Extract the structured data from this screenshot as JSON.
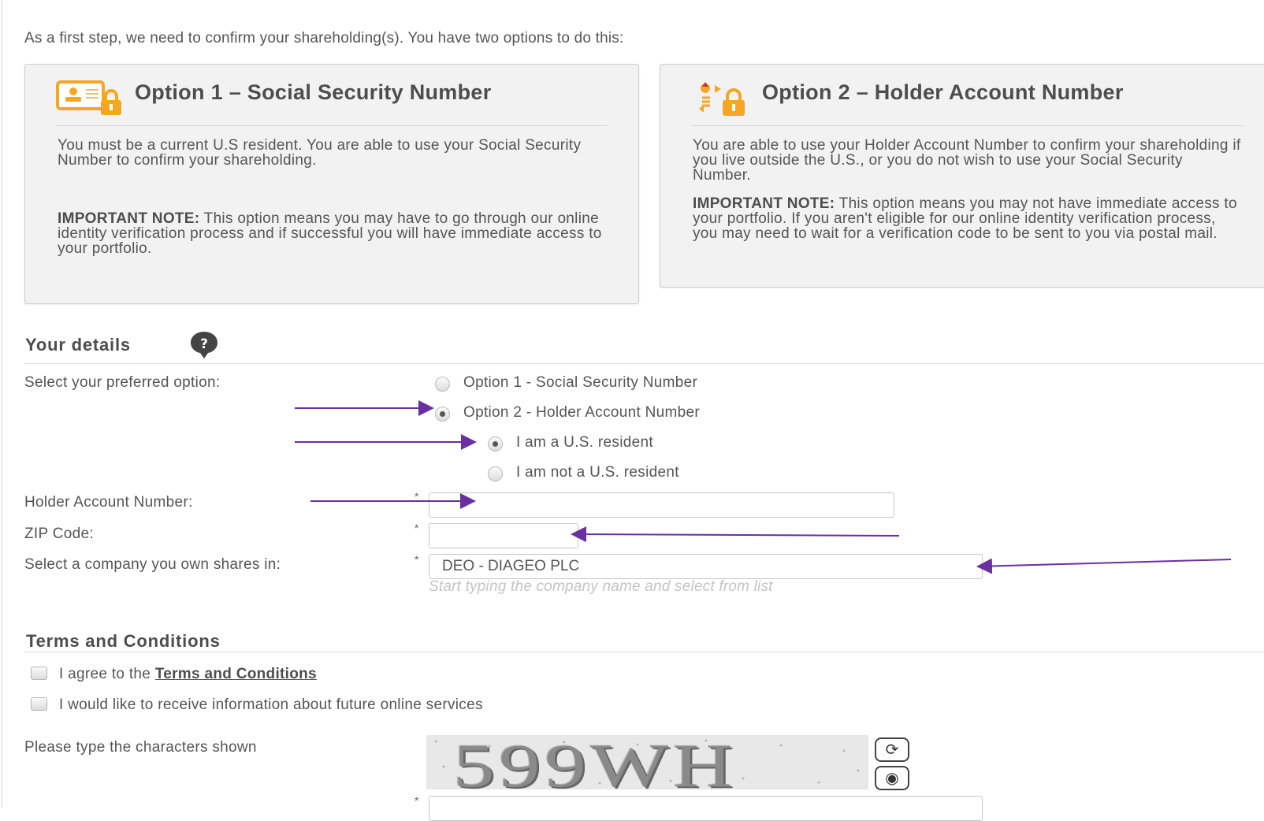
{
  "intro": "As a first step, we need to confirm your shareholding(s). You have two options to do this:",
  "options": [
    {
      "title": "Option 1 – Social Security Number",
      "icon": "id-card-lock-icon",
      "desc": "You must be a current U.S resident. You are able to use your Social Security Number to confirm your shareholding.",
      "note_label": "IMPORTANT NOTE:",
      "note": " This option means you may have to go through our online identity verification process and if successful you will have immediate access to your portfolio."
    },
    {
      "title": "Option 2 – Holder Account Number",
      "icon": "account-exchange-lock-icon",
      "desc": "You are able to use your Holder Account Number to confirm your shareholding if you live outside the U.S., or you do not wish to use your Social Security Number.",
      "note_label": "IMPORTANT NOTE:",
      "note": " This option means you may not have immediate access to your portfolio. If you aren't eligible for our online identity verification process, you may need to wait for a verification code to be sent to you via postal mail."
    }
  ],
  "details": {
    "title": "Your details",
    "preferred_label": "Select your preferred option:",
    "radio_opt1": "Option 1 - Social Security Number",
    "radio_opt2": "Option 2 - Holder Account Number",
    "resident_yes": "I am a U.S. resident",
    "resident_no": "I am not a U.S. resident",
    "selected_option": 2,
    "selected_residency": "yes",
    "required_mark": "*",
    "han_label": "Holder Account Number:",
    "han_value": "",
    "zip_label": "ZIP Code:",
    "zip_value": "",
    "company_label": "Select a company you own shares in:",
    "company_value": "DEO - DIAGEO PLC",
    "company_hint": "Start typing the company name and select from list"
  },
  "terms": {
    "title": "Terms and Conditions",
    "agree_prefix": "I agree to the ",
    "agree_link": "Terms and Conditions",
    "future_services": "I would like to receive information about future online services",
    "captcha_label": "Please type the characters shown",
    "captcha_text": "599WH",
    "captcha_value": ""
  },
  "colors": {
    "annotation_arrow": "#6a2fa0",
    "icon_orange": "#f5a623",
    "border": "#cfcfcf"
  }
}
